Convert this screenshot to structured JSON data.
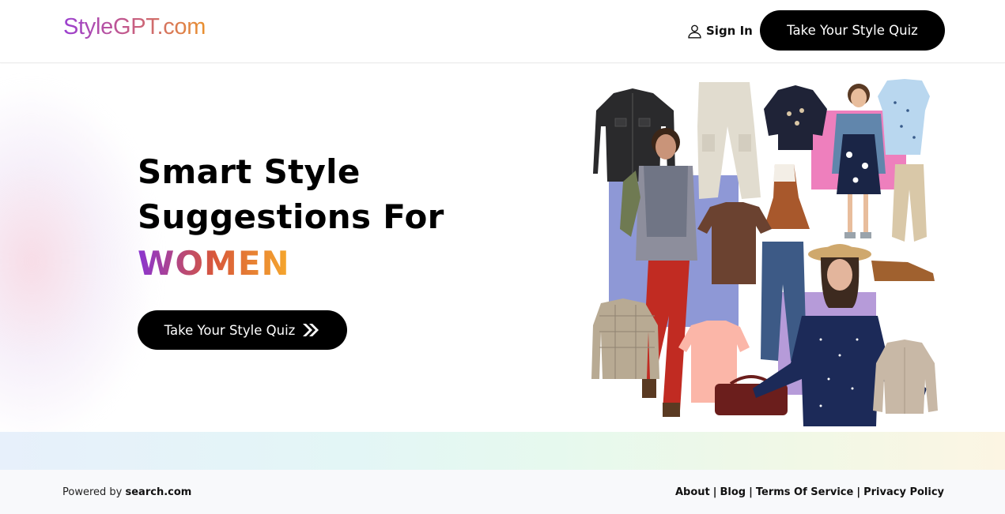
{
  "header": {
    "logo": "StyleGPT.com",
    "sign_in": "Sign In",
    "cta": "Take Your Style Quiz"
  },
  "hero": {
    "headline_line1": "Smart Style",
    "headline_line2": "Suggestions For",
    "highlight_word": "WOMEN",
    "cta": "Take Your Style Quiz"
  },
  "collage": {
    "items": [
      "denim-jacket",
      "cargo-pants",
      "kids-sweatshirt",
      "girl-model",
      "kids-dress",
      "man-model",
      "brown-tshirt",
      "pinafore-dress",
      "khaki-joggers",
      "jeans",
      "loafers",
      "woman-model",
      "plaid-shirt",
      "pink-tshirt",
      "handbag",
      "cardigan"
    ],
    "accent_colors": [
      "#8e98d6",
      "#ee7fbd",
      "#b69bd9"
    ]
  },
  "footer": {
    "powered_prefix": "Powered by",
    "powered_brand": "search.com",
    "links": [
      "About",
      "Blog",
      "Terms Of Service",
      "Privacy Policy"
    ]
  },
  "colors": {
    "brand_gradient_start": "#9b3fd1",
    "brand_gradient_end": "#e9902e",
    "button_bg": "#000000"
  }
}
